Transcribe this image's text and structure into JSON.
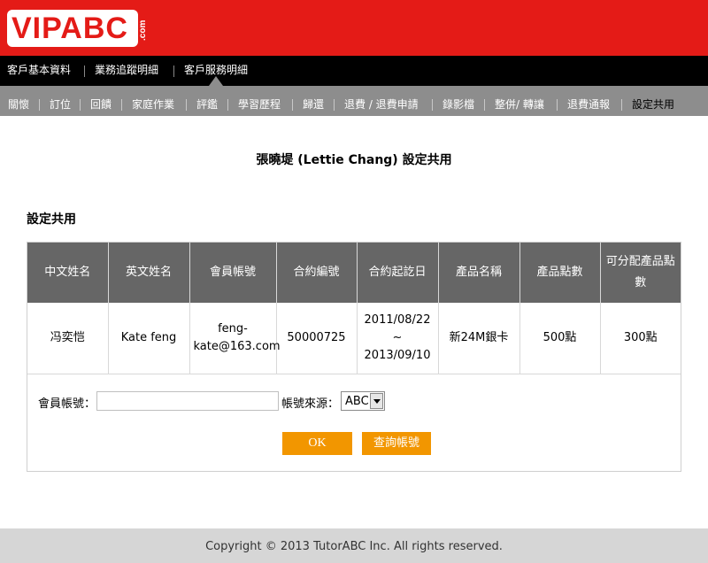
{
  "brand": {
    "logo_text": "VIPABC",
    "logo_suffix": ".com"
  },
  "top_nav": {
    "items": [
      "客戶基本資料",
      "業務追蹤明細",
      "客戶服務明細"
    ],
    "active_index": 2
  },
  "sub_nav": {
    "items": [
      "關懷",
      "訂位",
      "回饋",
      "家庭作業",
      "評鑑",
      "學習歷程",
      "歸還",
      "退費 / 退費申請",
      "錄影檔",
      "整併/ 轉讓",
      "退費通報",
      "設定共用"
    ],
    "active_index": 11
  },
  "page": {
    "title": "張曉堤 (Lettie Chang) 設定共用",
    "section_title": "設定共用"
  },
  "table": {
    "headers": [
      "中文姓名",
      "英文姓名",
      "會員帳號",
      "合約編號",
      "合約起訖日",
      "產品名稱",
      "產品點數",
      "可分配產品點數"
    ],
    "rows": [
      {
        "chinese_name": "冯奕恺",
        "english_name": "Kate feng",
        "account": "feng-kate@163.com",
        "contract_no": "50000725",
        "start_date": "2011/08/22",
        "date_sep": "~",
        "end_date": "2013/09/10",
        "product_name": "新24M銀卡",
        "product_points": "500點",
        "allocatable_points": "300點"
      }
    ]
  },
  "form": {
    "account_label": "會員帳號：",
    "account_value": "",
    "source_label": "帳號來源：",
    "source_selected": "ABC",
    "ok_label": "OK",
    "query_label": "查詢帳號"
  },
  "footer": {
    "copyright": "Copyright © 2013 TutorABC Inc. All rights reserved."
  },
  "colors": {
    "brand_red": "#e41b17",
    "button_orange": "#f29600",
    "header_gray": "#666666"
  }
}
